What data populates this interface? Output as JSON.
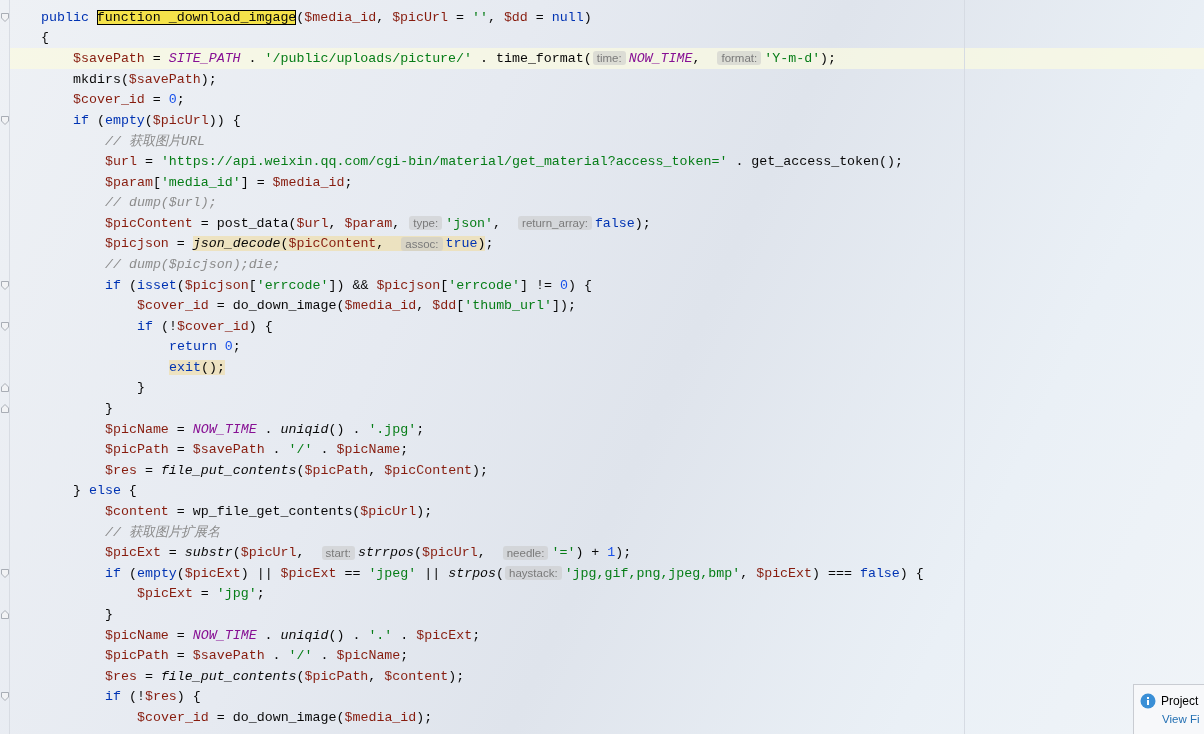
{
  "editor": {
    "lines": [
      {
        "kind": "opener",
        "current": false,
        "tokens": [
          {
            "kind": "keyword",
            "text": "public "
          },
          {
            "kind": "match",
            "text": "function _download_imgage"
          },
          {
            "kind": "plain",
            "text": "("
          },
          {
            "kind": "variable",
            "text": "$media_id"
          },
          {
            "kind": "plain",
            "text": ", "
          },
          {
            "kind": "variable",
            "text": "$picUrl"
          },
          {
            "kind": "plain",
            "text": " = "
          },
          {
            "kind": "string",
            "text": "''"
          },
          {
            "kind": "plain",
            "text": ", "
          },
          {
            "kind": "variable",
            "text": "$dd"
          },
          {
            "kind": "plain",
            "text": " = "
          },
          {
            "kind": "keyword",
            "text": "null"
          },
          {
            "kind": "plain",
            "text": ")"
          }
        ]
      },
      {
        "kind": "plain",
        "current": false,
        "tokens": [
          {
            "kind": "plain",
            "text": "{"
          }
        ],
        "children": [
          {
            "kind": "plain",
            "current": true,
            "tokens": [
              {
                "kind": "variable",
                "text": "$savePath"
              },
              {
                "kind": "plain",
                "text": " = "
              },
              {
                "kind": "constant",
                "text": "SITE_PATH"
              },
              {
                "kind": "plain",
                "text": " . "
              },
              {
                "kind": "string",
                "text": "'/public/uploads/picture/'"
              },
              {
                "kind": "plain",
                "text": " . time_format("
              },
              {
                "kind": "hint",
                "text": "time:"
              },
              {
                "kind": "constant",
                "text": "NOW_TIME"
              },
              {
                "kind": "plain",
                "text": ",  "
              },
              {
                "kind": "hint",
                "text": "format:"
              },
              {
                "kind": "string",
                "text": "'Y-m-d'"
              },
              {
                "kind": "plain",
                "text": ");"
              }
            ]
          },
          {
            "kind": "plain",
            "current": false,
            "tokens": [
              {
                "kind": "plain",
                "text": "mkdirs("
              },
              {
                "kind": "variable",
                "text": "$savePath"
              },
              {
                "kind": "plain",
                "text": ");"
              }
            ]
          },
          {
            "kind": "plain",
            "current": false,
            "tokens": [
              {
                "kind": "variable",
                "text": "$cover_id"
              },
              {
                "kind": "plain",
                "text": " = "
              },
              {
                "kind": "number",
                "text": "0"
              },
              {
                "kind": "plain",
                "text": ";"
              }
            ]
          },
          {
            "kind": "opener",
            "current": false,
            "tokens": [
              {
                "kind": "keyword",
                "text": "if"
              },
              {
                "kind": "plain",
                "text": " ("
              },
              {
                "kind": "keyword",
                "text": "empty"
              },
              {
                "kind": "plain",
                "text": "("
              },
              {
                "kind": "variable",
                "text": "$picUrl"
              },
              {
                "kind": "plain",
                "text": ")) {"
              }
            ],
            "children": [
              {
                "kind": "plain",
                "current": false,
                "tokens": [
                  {
                    "kind": "comment",
                    "text": "// 获取图片URL"
                  }
                ]
              },
              {
                "kind": "plain",
                "current": false,
                "tokens": [
                  {
                    "kind": "variable",
                    "text": "$url"
                  },
                  {
                    "kind": "plain",
                    "text": " = "
                  },
                  {
                    "kind": "string",
                    "text": "'https://api.weixin.qq.com/cgi-bin/material/get_material?access_token='"
                  },
                  {
                    "kind": "plain",
                    "text": " . get_access_token();"
                  }
                ]
              },
              {
                "kind": "plain",
                "current": false,
                "tokens": [
                  {
                    "kind": "variable",
                    "text": "$param"
                  },
                  {
                    "kind": "plain",
                    "text": "["
                  },
                  {
                    "kind": "string",
                    "text": "'media_id'"
                  },
                  {
                    "kind": "plain",
                    "text": "] = "
                  },
                  {
                    "kind": "variable",
                    "text": "$media_id"
                  },
                  {
                    "kind": "plain",
                    "text": ";"
                  }
                ]
              },
              {
                "kind": "plain",
                "current": false,
                "tokens": [
                  {
                    "kind": "comment",
                    "text": "// dump($url);"
                  }
                ]
              },
              {
                "kind": "plain",
                "current": false,
                "tokens": [
                  {
                    "kind": "variable",
                    "text": "$picContent"
                  },
                  {
                    "kind": "plain",
                    "text": " = post_data("
                  },
                  {
                    "kind": "variable",
                    "text": "$url"
                  },
                  {
                    "kind": "plain",
                    "text": ", "
                  },
                  {
                    "kind": "variable",
                    "text": "$param"
                  },
                  {
                    "kind": "plain",
                    "text": ", "
                  },
                  {
                    "kind": "hint",
                    "text": "type:"
                  },
                  {
                    "kind": "string",
                    "text": "'json'"
                  },
                  {
                    "kind": "plain",
                    "text": ",  "
                  },
                  {
                    "kind": "hint",
                    "text": "return_array:"
                  },
                  {
                    "kind": "keyword",
                    "text": "false"
                  },
                  {
                    "kind": "plain",
                    "text": ");"
                  }
                ]
              },
              {
                "kind": "plain",
                "current": false,
                "tokens": [
                  {
                    "kind": "variable",
                    "text": "$picjson"
                  },
                  {
                    "kind": "plain",
                    "text": " = "
                  },
                  {
                    "kind": "usage",
                    "tokens": [
                      {
                        "kind": "function",
                        "text": "json_decode"
                      },
                      {
                        "kind": "plain",
                        "text": "("
                      },
                      {
                        "kind": "variable",
                        "text": "$picContent"
                      },
                      {
                        "kind": "plain",
                        "text": ",  "
                      },
                      {
                        "kind": "hint",
                        "text": "assoc:"
                      },
                      {
                        "kind": "keyword",
                        "text": "true"
                      },
                      {
                        "kind": "plain",
                        "text": ")"
                      }
                    ]
                  },
                  {
                    "kind": "plain",
                    "text": ";"
                  }
                ]
              },
              {
                "kind": "plain",
                "current": false,
                "tokens": [
                  {
                    "kind": "comment",
                    "text": "// dump($picjson);die;"
                  }
                ]
              },
              {
                "kind": "opener",
                "current": false,
                "tokens": [
                  {
                    "kind": "keyword",
                    "text": "if"
                  },
                  {
                    "kind": "plain",
                    "text": " ("
                  },
                  {
                    "kind": "keyword",
                    "text": "isset"
                  },
                  {
                    "kind": "plain",
                    "text": "("
                  },
                  {
                    "kind": "variable",
                    "text": "$picjson"
                  },
                  {
                    "kind": "plain",
                    "text": "["
                  },
                  {
                    "kind": "string",
                    "text": "'errcode'"
                  },
                  {
                    "kind": "plain",
                    "text": "]) && "
                  },
                  {
                    "kind": "variable",
                    "text": "$picjson"
                  },
                  {
                    "kind": "plain",
                    "text": "["
                  },
                  {
                    "kind": "string",
                    "text": "'errcode'"
                  },
                  {
                    "kind": "plain",
                    "text": "] != "
                  },
                  {
                    "kind": "number",
                    "text": "0"
                  },
                  {
                    "kind": "plain",
                    "text": ") {"
                  }
                ],
                "children": [
                  {
                    "kind": "plain",
                    "current": false,
                    "tokens": [
                      {
                        "kind": "variable",
                        "text": "$cover_id"
                      },
                      {
                        "kind": "plain",
                        "text": " = do_down_image("
                      },
                      {
                        "kind": "variable",
                        "text": "$media_id"
                      },
                      {
                        "kind": "plain",
                        "text": ", "
                      },
                      {
                        "kind": "variable",
                        "text": "$dd"
                      },
                      {
                        "kind": "plain",
                        "text": "["
                      },
                      {
                        "kind": "string",
                        "text": "'thumb_url'"
                      },
                      {
                        "kind": "plain",
                        "text": "]);"
                      }
                    ]
                  },
                  {
                    "kind": "opener",
                    "current": false,
                    "tokens": [
                      {
                        "kind": "keyword",
                        "text": "if"
                      },
                      {
                        "kind": "plain",
                        "text": " (!"
                      },
                      {
                        "kind": "variable",
                        "text": "$cover_id"
                      },
                      {
                        "kind": "plain",
                        "text": ") {"
                      }
                    ],
                    "children": [
                      {
                        "kind": "plain",
                        "current": false,
                        "tokens": [
                          {
                            "kind": "keyword",
                            "text": "return "
                          },
                          {
                            "kind": "number",
                            "text": "0"
                          },
                          {
                            "kind": "plain",
                            "text": ";"
                          }
                        ]
                      },
                      {
                        "kind": "plain",
                        "current": false,
                        "tokens": [
                          {
                            "kind": "usage",
                            "tokens": [
                              {
                                "kind": "keyword",
                                "text": "exit"
                              },
                              {
                                "kind": "plain",
                                "text": "();"
                              }
                            ]
                          }
                        ]
                      }
                    ]
                  },
                  {
                    "kind": "closer",
                    "current": false,
                    "tokens": [
                      {
                        "kind": "plain",
                        "text": "}"
                      }
                    ]
                  }
                ]
              },
              {
                "kind": "closer",
                "current": false,
                "tokens": [
                  {
                    "kind": "plain",
                    "text": "}"
                  }
                ]
              },
              {
                "kind": "plain",
                "current": false,
                "tokens": [
                  {
                    "kind": "variable",
                    "text": "$picName"
                  },
                  {
                    "kind": "plain",
                    "text": " = "
                  },
                  {
                    "kind": "constant",
                    "text": "NOW_TIME"
                  },
                  {
                    "kind": "plain",
                    "text": " . "
                  },
                  {
                    "kind": "function",
                    "text": "uniqid"
                  },
                  {
                    "kind": "plain",
                    "text": "() . "
                  },
                  {
                    "kind": "string",
                    "text": "'.jpg'"
                  },
                  {
                    "kind": "plain",
                    "text": ";"
                  }
                ]
              },
              {
                "kind": "plain",
                "current": false,
                "tokens": [
                  {
                    "kind": "variable",
                    "text": "$picPath"
                  },
                  {
                    "kind": "plain",
                    "text": " = "
                  },
                  {
                    "kind": "variable",
                    "text": "$savePath"
                  },
                  {
                    "kind": "plain",
                    "text": " . "
                  },
                  {
                    "kind": "string",
                    "text": "'/'"
                  },
                  {
                    "kind": "plain",
                    "text": " . "
                  },
                  {
                    "kind": "variable",
                    "text": "$picName"
                  },
                  {
                    "kind": "plain",
                    "text": ";"
                  }
                ]
              },
              {
                "kind": "plain",
                "current": false,
                "tokens": [
                  {
                    "kind": "variable",
                    "text": "$res"
                  },
                  {
                    "kind": "plain",
                    "text": " = "
                  },
                  {
                    "kind": "function",
                    "text": "file_put_contents"
                  },
                  {
                    "kind": "plain",
                    "text": "("
                  },
                  {
                    "kind": "variable",
                    "text": "$picPath"
                  },
                  {
                    "kind": "plain",
                    "text": ", "
                  },
                  {
                    "kind": "variable",
                    "text": "$picContent"
                  },
                  {
                    "kind": "plain",
                    "text": ");"
                  }
                ]
              }
            ]
          },
          {
            "kind": "plain",
            "current": false,
            "tokens": [
              {
                "kind": "plain",
                "text": "} "
              },
              {
                "kind": "keyword",
                "text": "else"
              },
              {
                "kind": "plain",
                "text": " {"
              }
            ],
            "children": [
              {
                "kind": "plain",
                "current": false,
                "tokens": [
                  {
                    "kind": "variable",
                    "text": "$content"
                  },
                  {
                    "kind": "plain",
                    "text": " = wp_file_get_contents("
                  },
                  {
                    "kind": "variable",
                    "text": "$picUrl"
                  },
                  {
                    "kind": "plain",
                    "text": ");"
                  }
                ]
              },
              {
                "kind": "plain",
                "current": false,
                "tokens": [
                  {
                    "kind": "comment",
                    "text": "// 获取图片扩展名"
                  }
                ]
              },
              {
                "kind": "plain",
                "current": false,
                "tokens": [
                  {
                    "kind": "variable",
                    "text": "$picExt"
                  },
                  {
                    "kind": "plain",
                    "text": " = "
                  },
                  {
                    "kind": "function",
                    "text": "substr"
                  },
                  {
                    "kind": "plain",
                    "text": "("
                  },
                  {
                    "kind": "variable",
                    "text": "$picUrl"
                  },
                  {
                    "kind": "plain",
                    "text": ",  "
                  },
                  {
                    "kind": "hint",
                    "text": "start:"
                  },
                  {
                    "kind": "function",
                    "text": "strrpos"
                  },
                  {
                    "kind": "plain",
                    "text": "("
                  },
                  {
                    "kind": "variable",
                    "text": "$picUrl"
                  },
                  {
                    "kind": "plain",
                    "text": ",  "
                  },
                  {
                    "kind": "hint",
                    "text": "needle:"
                  },
                  {
                    "kind": "string",
                    "text": "'='"
                  },
                  {
                    "kind": "plain",
                    "text": ") + "
                  },
                  {
                    "kind": "number",
                    "text": "1"
                  },
                  {
                    "kind": "plain",
                    "text": ");"
                  }
                ]
              },
              {
                "kind": "opener",
                "current": false,
                "tokens": [
                  {
                    "kind": "keyword",
                    "text": "if"
                  },
                  {
                    "kind": "plain",
                    "text": " ("
                  },
                  {
                    "kind": "keyword",
                    "text": "empty"
                  },
                  {
                    "kind": "plain",
                    "text": "("
                  },
                  {
                    "kind": "variable",
                    "text": "$picExt"
                  },
                  {
                    "kind": "plain",
                    "text": ") || "
                  },
                  {
                    "kind": "variable",
                    "text": "$picExt"
                  },
                  {
                    "kind": "plain",
                    "text": " == "
                  },
                  {
                    "kind": "string",
                    "text": "'jpeg'"
                  },
                  {
                    "kind": "plain",
                    "text": " || "
                  },
                  {
                    "kind": "function",
                    "text": "strpos"
                  },
                  {
                    "kind": "plain",
                    "text": "("
                  },
                  {
                    "kind": "hint",
                    "text": "haystack:"
                  },
                  {
                    "kind": "string",
                    "text": "'jpg,gif,png,jpeg,bmp'"
                  },
                  {
                    "kind": "plain",
                    "text": ", "
                  },
                  {
                    "kind": "variable",
                    "text": "$picExt"
                  },
                  {
                    "kind": "plain",
                    "text": ") === "
                  },
                  {
                    "kind": "keyword",
                    "text": "false"
                  },
                  {
                    "kind": "plain",
                    "text": ") {"
                  }
                ],
                "children": [
                  {
                    "kind": "plain",
                    "current": false,
                    "tokens": [
                      {
                        "kind": "variable",
                        "text": "$picExt"
                      },
                      {
                        "kind": "plain",
                        "text": " = "
                      },
                      {
                        "kind": "string",
                        "text": "'jpg'"
                      },
                      {
                        "kind": "plain",
                        "text": ";"
                      }
                    ]
                  }
                ]
              },
              {
                "kind": "closer",
                "current": false,
                "tokens": [
                  {
                    "kind": "plain",
                    "text": "}"
                  }
                ]
              },
              {
                "kind": "plain",
                "current": false,
                "tokens": [
                  {
                    "kind": "variable",
                    "text": "$picName"
                  },
                  {
                    "kind": "plain",
                    "text": " = "
                  },
                  {
                    "kind": "constant",
                    "text": "NOW_TIME"
                  },
                  {
                    "kind": "plain",
                    "text": " . "
                  },
                  {
                    "kind": "function",
                    "text": "uniqid"
                  },
                  {
                    "kind": "plain",
                    "text": "() . "
                  },
                  {
                    "kind": "string",
                    "text": "'.'"
                  },
                  {
                    "kind": "plain",
                    "text": " . "
                  },
                  {
                    "kind": "variable",
                    "text": "$picExt"
                  },
                  {
                    "kind": "plain",
                    "text": ";"
                  }
                ]
              },
              {
                "kind": "plain",
                "current": false,
                "tokens": [
                  {
                    "kind": "variable",
                    "text": "$picPath"
                  },
                  {
                    "kind": "plain",
                    "text": " = "
                  },
                  {
                    "kind": "variable",
                    "text": "$savePath"
                  },
                  {
                    "kind": "plain",
                    "text": " . "
                  },
                  {
                    "kind": "string",
                    "text": "'/'"
                  },
                  {
                    "kind": "plain",
                    "text": " . "
                  },
                  {
                    "kind": "variable",
                    "text": "$picName"
                  },
                  {
                    "kind": "plain",
                    "text": ";"
                  }
                ]
              },
              {
                "kind": "plain",
                "current": false,
                "tokens": [
                  {
                    "kind": "variable",
                    "text": "$res"
                  },
                  {
                    "kind": "plain",
                    "text": " = "
                  },
                  {
                    "kind": "function",
                    "text": "file_put_contents"
                  },
                  {
                    "kind": "plain",
                    "text": "("
                  },
                  {
                    "kind": "variable",
                    "text": "$picPath"
                  },
                  {
                    "kind": "plain",
                    "text": ", "
                  },
                  {
                    "kind": "variable",
                    "text": "$content"
                  },
                  {
                    "kind": "plain",
                    "text": ");"
                  }
                ]
              },
              {
                "kind": "opener",
                "current": false,
                "tokens": [
                  {
                    "kind": "keyword",
                    "text": "if"
                  },
                  {
                    "kind": "plain",
                    "text": " (!"
                  },
                  {
                    "kind": "variable",
                    "text": "$res"
                  },
                  {
                    "kind": "plain",
                    "text": ") {"
                  }
                ],
                "children": [
                  {
                    "kind": "plain",
                    "current": false,
                    "tokens": [
                      {
                        "kind": "variable",
                        "text": "$cover_id"
                      },
                      {
                        "kind": "plain",
                        "text": " = do_down_image("
                      },
                      {
                        "kind": "variable",
                        "text": "$media_id"
                      },
                      {
                        "kind": "plain",
                        "text": ");"
                      }
                    ]
                  }
                ]
              }
            ]
          }
        ]
      }
    ]
  },
  "notification": {
    "title": "Project",
    "link": "View Fi"
  }
}
